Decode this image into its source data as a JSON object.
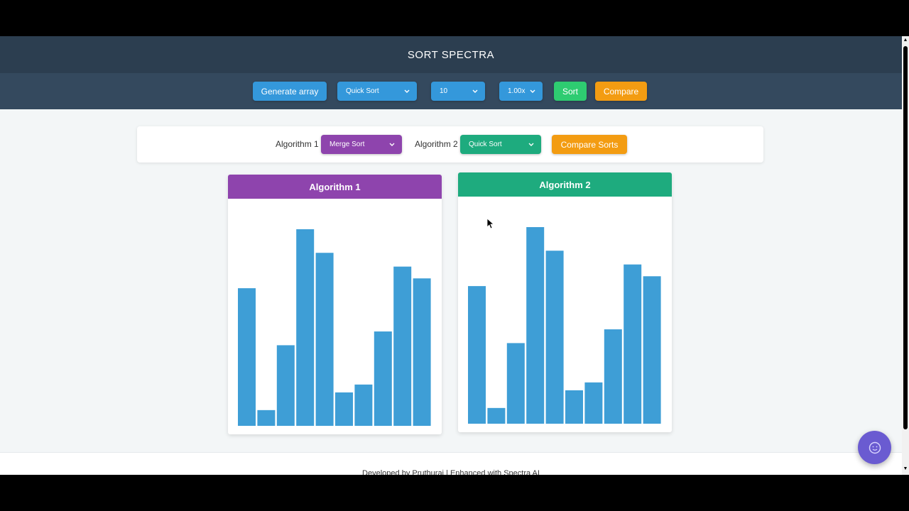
{
  "header": {
    "title": "SORT SPECTRA"
  },
  "toolbar": {
    "generate_label": "Generate array",
    "algorithm_select": "Quick Sort",
    "size_select": "10",
    "speed_select": "1.00x",
    "sort_label": "Sort",
    "compare_label": "Compare"
  },
  "compare_panel": {
    "algo1_label": "Algorithm 1",
    "algo1_select": "Merge Sort",
    "algo2_label": "Algorithm 2",
    "algo2_select": "Quick Sort",
    "compare_sorts_label": "Compare Sorts"
  },
  "cards": [
    {
      "title": "Algorithm 1",
      "color": "#8e44ad"
    },
    {
      "title": "Algorithm 2",
      "color": "#1eab7e"
    }
  ],
  "bar_color": "#3e9ed6",
  "chart_data": [
    {
      "type": "bar",
      "title": "Algorithm 1",
      "values": [
        70,
        8,
        41,
        100,
        88,
        17,
        21,
        48,
        81,
        75
      ]
    },
    {
      "type": "bar",
      "title": "Algorithm 2",
      "values": [
        70,
        8,
        41,
        100,
        88,
        17,
        21,
        48,
        81,
        75
      ]
    }
  ],
  "footer": {
    "text": "Developed by Pruthuraj | Enhanced with Spectra AI"
  },
  "icons": {
    "fab": "chat-bot-icon",
    "chevron": "chevron-down-icon"
  }
}
